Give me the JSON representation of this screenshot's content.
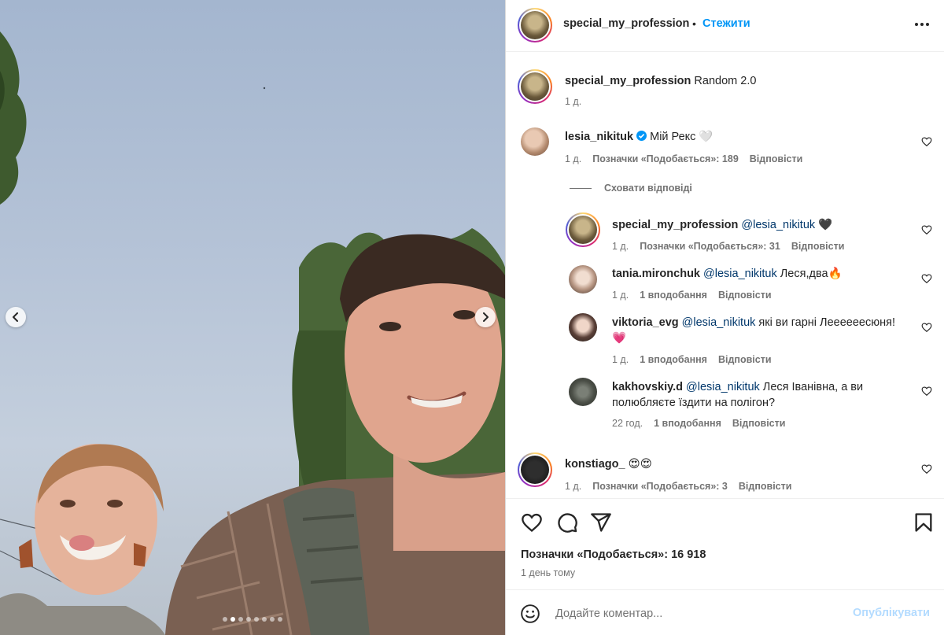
{
  "post": {
    "author": "special_my_profession",
    "separator": "•",
    "follow_label": "Стежити",
    "caption_user": "special_my_profession",
    "caption_text": "Random 2.0",
    "caption_time": "1 д."
  },
  "carousel": {
    "slide_count": 8,
    "active_index": 1
  },
  "comments": [
    {
      "user": "lesia_nikituk",
      "verified": true,
      "text": "Мій Рекс 🤍",
      "time": "1 д.",
      "likes": "Позначки «Подобається»: 189",
      "reply": "Відповісти"
    },
    {
      "user": "konstiago_",
      "text": "😍😍",
      "time": "1 д.",
      "likes": "Позначки «Подобається»: 3",
      "reply": "Відповісти"
    }
  ],
  "hide_replies_label": "Сховати відповіді",
  "replies": [
    {
      "user": "special_my_profession",
      "mention": "@lesia_nikituk",
      "text": "🖤",
      "time": "1 д.",
      "likes": "Позначки «Подобається»: 31",
      "reply": "Відповісти"
    },
    {
      "user": "tania.mironchuk",
      "mention": "@lesia_nikituk",
      "text": "Леся,два🔥",
      "time": "1 д.",
      "likes": "1 вподобання",
      "reply": "Відповісти"
    },
    {
      "user": "viktoria_evg",
      "mention": "@lesia_nikituk",
      "text": "які ви гарні Леееееесюня!",
      "text2": "💗",
      "time": "1 д.",
      "likes": "1 вподобання",
      "reply": "Відповісти"
    },
    {
      "user": "kakhovskiy.d",
      "mention": "@lesia_nikituk",
      "text": "Леся Іванівна, а ви",
      "text2": "полюбляєте їздити на полігон?",
      "time": "22 год.",
      "likes": "1 вподобання",
      "reply": "Відповісти"
    }
  ],
  "footer": {
    "likes_total": "Позначки «Подобається»: 16 918",
    "date": "1 день тому",
    "comment_placeholder": "Додайте коментар...",
    "post_label": "Опублікувати"
  },
  "icons": [
    "chevron-left-icon",
    "chevron-right-icon",
    "more-icon",
    "heart-icon",
    "comment-icon",
    "share-icon",
    "bookmark-icon",
    "emoji-icon",
    "verified-badge-icon"
  ],
  "colors": {
    "follow": "#0095f6",
    "mention": "#00376b",
    "muted": "#737373",
    "post_disabled": "#b3dbff"
  }
}
